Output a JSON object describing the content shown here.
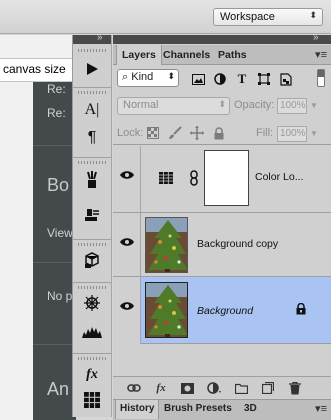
{
  "options_bar": {
    "workspace_label": "Workspace"
  },
  "webpage": {
    "search_text": "canvas size",
    "items": [
      "Re:",
      "Re:",
      "Bo",
      "View",
      "No p",
      "An"
    ]
  },
  "tools_panel": {
    "icons": [
      "play-icon",
      "character-icon",
      "paragraph-icon",
      "brush-presets-icon",
      "clone-source-icon",
      "3d-icon",
      "navigator-icon",
      "histogram-icon",
      "fx-styles-icon",
      "swatches-icon"
    ]
  },
  "layers_panel": {
    "tabs": [
      "Layers",
      "Channels",
      "Paths"
    ],
    "active_tab": "Layers",
    "filter": {
      "kind_label": "Kind"
    },
    "blend_mode": "Normal",
    "opacity_label": "Opacity:",
    "opacity_value": "100%",
    "lock_label": "Lock:",
    "fill_label": "Fill:",
    "fill_value": "100%",
    "layers": [
      {
        "name": "Color Lo...",
        "visible": true,
        "selected": false,
        "type": "adjustment"
      },
      {
        "name": "Background copy",
        "visible": true,
        "selected": false,
        "type": "image"
      },
      {
        "name": "Background",
        "visible": true,
        "selected": true,
        "type": "image",
        "locked": true
      }
    ],
    "bottom_icons": [
      "link-layers-icon",
      "fx-icon",
      "add-mask-icon",
      "adjustment-layer-icon",
      "new-group-icon",
      "new-layer-icon",
      "delete-layer-icon"
    ]
  },
  "bottom_tabs": [
    "History",
    "Brush Presets",
    "3D"
  ],
  "active_bottom_tab": "History",
  "colors": {
    "selection": "#a9c4f3",
    "dark_panel": "#44494b",
    "panel_bg": "#d0d0d0"
  }
}
